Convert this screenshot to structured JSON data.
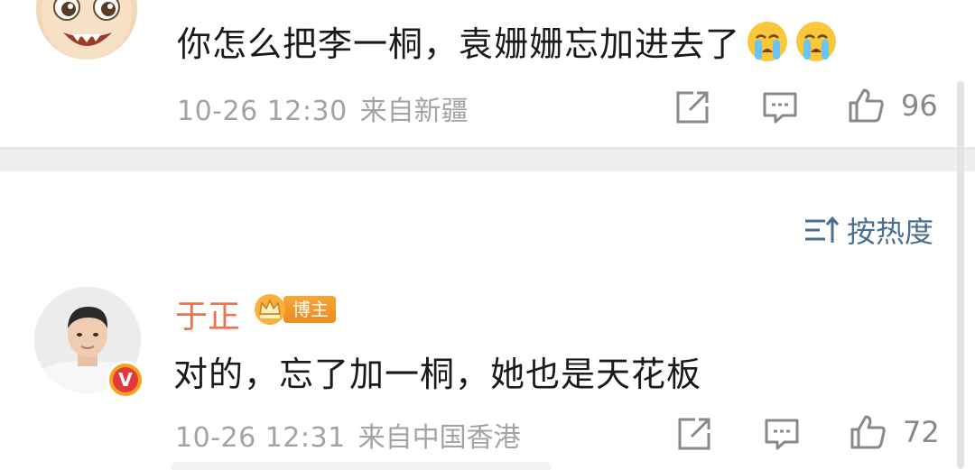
{
  "comments": [
    {
      "avatar_icon": "cartoon-avatar",
      "text": "你怎么把李一桐，袁姗姗忘加进去了",
      "emojis": [
        "crying-emoji",
        "crying-emoji"
      ],
      "time": "10-26 12:30",
      "source": "来自新疆",
      "like_count": "96"
    },
    {
      "avatar_icon": "user-photo-avatar",
      "verified_badge": "V",
      "author": "于正",
      "author_badge": "博主",
      "text": "对的，忘了加一桐，她也是天花板",
      "time": "10-26 12:31",
      "source": "来自中国香港",
      "like_count": "72"
    }
  ],
  "sort": {
    "icon": "sort-icon",
    "label": "按热度"
  },
  "colors": {
    "author_name": "#eb7350",
    "sort_label": "#4a6e8e",
    "meta_text": "#a3a3a3",
    "badge_orange": "#f5a638"
  }
}
